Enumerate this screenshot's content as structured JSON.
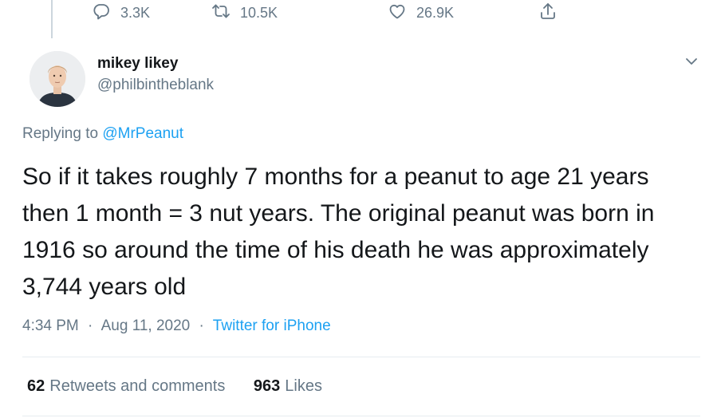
{
  "actions": {
    "reply_count": "3.3K",
    "retweet_count": "10.5K",
    "like_count": "26.9K",
    "icons": [
      "reply-icon",
      "retweet-icon",
      "like-icon",
      "share-icon"
    ]
  },
  "author": {
    "name": "mikey likey",
    "handle": "@philbintheblank"
  },
  "replying": {
    "prefix": "Replying to",
    "mention": "@MrPeanut"
  },
  "tweet": {
    "text": "So if it takes roughly 7 months for a peanut to age 21 years then 1 month = 3 nut years. The original peanut was born in 1916 so around the time of his death he was approximately 3,744 years old"
  },
  "meta": {
    "time": "4:34 PM",
    "separator": "·",
    "date": "Aug 11, 2020",
    "source": "Twitter for iPhone"
  },
  "stats": {
    "retweets_count": "62",
    "retweets_label": "Retweets and comments",
    "likes_count": "963",
    "likes_label": "Likes"
  },
  "colors": {
    "text": "#14171a",
    "secondary": "#657786",
    "accent": "#1da1f2",
    "divider": "#e6ecf0"
  }
}
